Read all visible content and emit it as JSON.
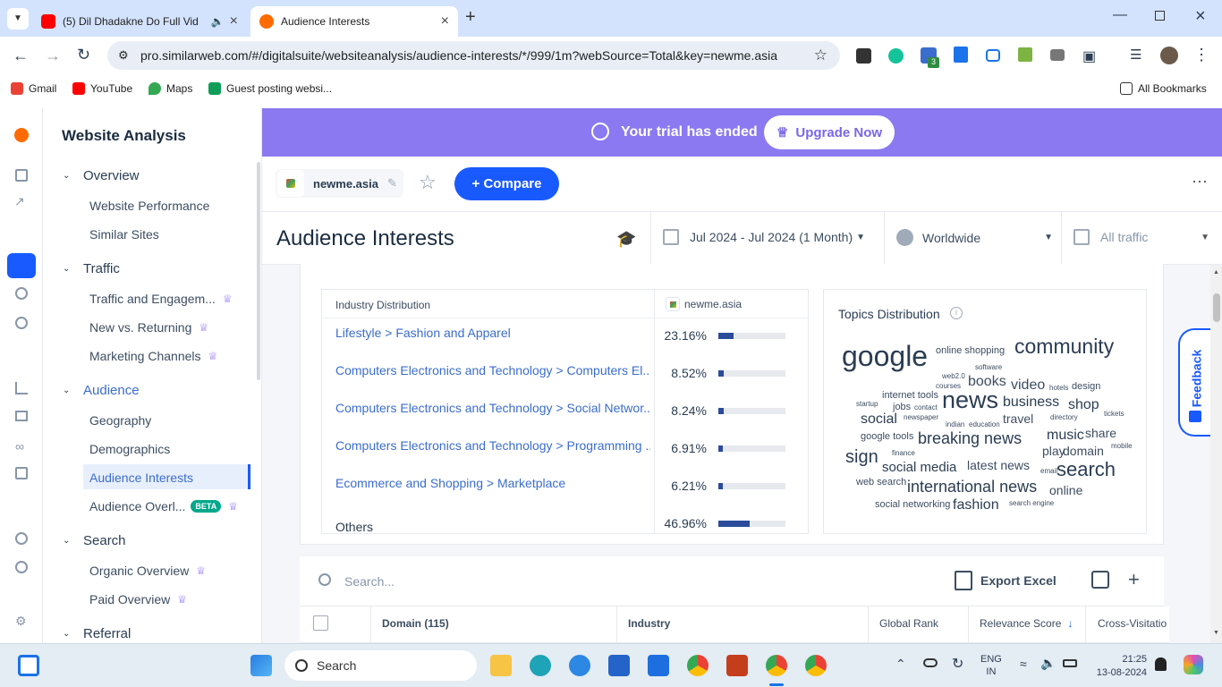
{
  "browser": {
    "tabs": [
      {
        "title": "(5) Dil Dhadakne Do Full Vid",
        "active": false
      },
      {
        "title": "Audience Interests",
        "active": true
      }
    ],
    "url": "pro.similarweb.com/#/digitalsuite/websiteanalysis/audience-interests/*/999/1m?webSource=Total&key=newme.asia",
    "bookmarks": [
      "Gmail",
      "YouTube",
      "Maps",
      "Guest posting websi..."
    ],
    "all_bookmarks": "All Bookmarks",
    "ext_badge": "3"
  },
  "sidebar": {
    "title": "Website Analysis",
    "sections": [
      {
        "label": "Overview",
        "items": [
          {
            "label": "Website Performance"
          },
          {
            "label": "Similar Sites"
          }
        ]
      },
      {
        "label": "Traffic",
        "items": [
          {
            "label": "Traffic and Engagem..."
          },
          {
            "label": "New vs. Returning"
          },
          {
            "label": "Marketing Channels"
          }
        ]
      },
      {
        "label": "Audience",
        "items": [
          {
            "label": "Geography"
          },
          {
            "label": "Demographics"
          },
          {
            "label": "Audience Interests"
          },
          {
            "label": "Audience Overl..."
          }
        ]
      },
      {
        "label": "Search",
        "items": [
          {
            "label": "Organic Overview"
          },
          {
            "label": "Paid Overview"
          }
        ]
      },
      {
        "label": "Referral",
        "items": []
      }
    ],
    "beta_badge": "BETA"
  },
  "banner": {
    "text": "Your trial has ended",
    "button": "Upgrade Now"
  },
  "site": {
    "domain": "newme.asia",
    "compare_label": "+ Compare"
  },
  "page": {
    "title": "Audience Interests",
    "date_range": "Jul 2024 - Jul 2024 (1 Month)",
    "country": "Worldwide",
    "traffic": "All traffic"
  },
  "industry": {
    "header_left": "Industry Distribution",
    "header_right": "newme.asia",
    "rows": [
      {
        "name": "Lifestyle > Fashion and Apparel",
        "pct": "23.16%",
        "share": 0.2316
      },
      {
        "name": "Computers Electronics and Technology > Computers El...",
        "pct": "8.52%",
        "share": 0.0852
      },
      {
        "name": "Computers Electronics and Technology > Social Networ...",
        "pct": "8.24%",
        "share": 0.0824
      },
      {
        "name": "Computers Electronics and Technology > Programming ...",
        "pct": "6.91%",
        "share": 0.0691
      },
      {
        "name": "Ecommerce and Shopping > Marketplace",
        "pct": "6.21%",
        "share": 0.0621
      },
      {
        "name": "Others",
        "pct": "46.96%",
        "share": 0.4696
      }
    ]
  },
  "topics": {
    "title": "Topics Distribution",
    "words": [
      "google",
      "online shopping",
      "community",
      "web2.0",
      "software",
      "books",
      "video",
      "hotels",
      "design",
      "courses",
      "internet tools",
      "startup",
      "jobs",
      "contact",
      "news",
      "business",
      "shop",
      "social",
      "newspaper",
      "indian",
      "education",
      "travel",
      "directory",
      "tickets",
      "google tools",
      "breaking news",
      "music",
      "share",
      "finance",
      "play",
      "domain",
      "mobile",
      "sign",
      "social media",
      "latest news",
      "email",
      "search",
      "web search",
      "international news",
      "online",
      "social networking",
      "fashion",
      "search engine"
    ]
  },
  "table": {
    "search_placeholder": "Search...",
    "export_label": "Export Excel",
    "columns": [
      "Domain (115)",
      "Industry",
      "Global Rank",
      "Relevance Score",
      "Cross-Visitatio"
    ]
  },
  "feedback": "Feedback",
  "taskbar": {
    "search": "Search",
    "lang": "ENG",
    "region": "IN",
    "time": "21:25",
    "date": "13-08-2024"
  },
  "colors": {
    "brand": "#8a79f0",
    "accent": "#195aff",
    "link": "#3b6dcc",
    "bar": "#2b4b9b"
  }
}
